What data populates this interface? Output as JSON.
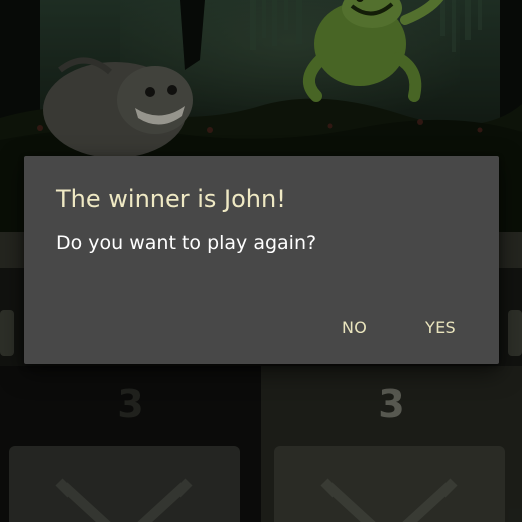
{
  "dialog": {
    "title": "The winner is John!",
    "message": "Do you want to play again?",
    "negative_label": "NO",
    "positive_label": "YES"
  },
  "scoreboard": {
    "left_score": "3",
    "right_score": "3"
  },
  "colors": {
    "dialog_background": "#484848",
    "dialog_title": "#efe9c4",
    "dialog_buttons": "#e9e4bd",
    "score_active": "#8d8f82",
    "score_inactive": "#34362f"
  },
  "icons": {
    "left_card": "crossed-swords-icon",
    "right_card": "crossed-swords-icon"
  }
}
